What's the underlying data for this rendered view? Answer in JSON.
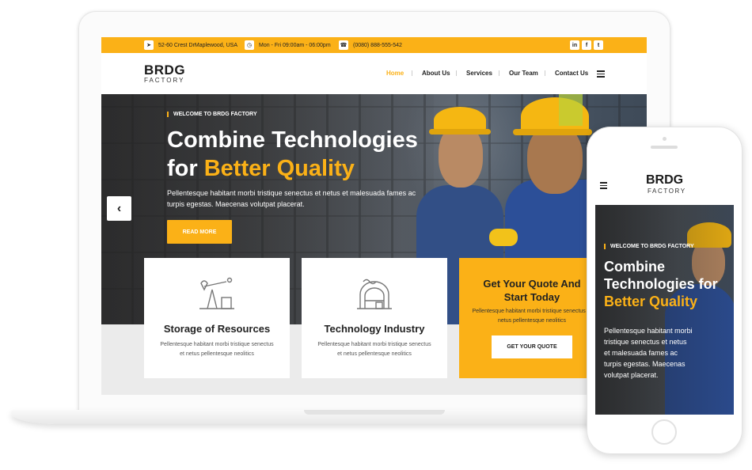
{
  "colors": {
    "accent": "#fbb117",
    "dark": "#222222",
    "white": "#ffffff"
  },
  "topbar": {
    "address": "52-60 Crest DrMaplewood, USA",
    "hours": "Mon - Fri 09:00am - 06:00pm",
    "phone": "(0080) 888-555-542",
    "address_icon": "location-arrow-icon",
    "hours_icon": "clock-icon",
    "phone_icon": "phone-icon",
    "social": [
      {
        "name": "linkedin-icon",
        "glyph": "in"
      },
      {
        "name": "facebook-icon",
        "glyph": "f"
      },
      {
        "name": "twitter-icon",
        "glyph": "t"
      }
    ]
  },
  "logo": {
    "main": "BRDG",
    "sub": "FACTORY"
  },
  "nav": {
    "items": [
      "Home",
      "About Us",
      "Services",
      "Our Team",
      "Contact Us"
    ],
    "active": "Home",
    "menu_icon": "hamburger-icon"
  },
  "hero": {
    "tag": "WELCOME TO BRDG FACTORY",
    "title_line1": "Combine Technologies",
    "title_line2_prefix": "for ",
    "title_highlight": "Better Quality",
    "text": "Pellentesque habitant morbi tristique senectus et netus et malesuada fames ac turpis egestas. Maecenas volutpat placerat.",
    "button": "READ MORE",
    "prev_icon": "chevron-left-icon"
  },
  "cards": [
    {
      "title": "Storage of Resources",
      "text": "Pellentesque habitant morbi tristique senectus et netus pellentesque neolitics",
      "icon": "oil-pump-icon"
    },
    {
      "title": "Technology Industry",
      "text": "Pellentesque habitant morbi tristique senectus et netus pellentesque neolitics",
      "icon": "warehouse-icon"
    }
  ],
  "quote": {
    "title": "Get Your Quote And Start Today",
    "text": "Pellentesque habitant morbi tristique senectus et netus pellentesque neolitics",
    "button": "GET YOUR QUOTE"
  },
  "phone": {
    "logo_main": "BRDG",
    "logo_sub": "FACTORY",
    "tag": "WELCOME TO BRDG FACTORY",
    "title_line1": "Combine",
    "title_line2": "Technologies for",
    "title_highlight": "Better Quality",
    "text": "Pellentesque habitant morbi tristique senectus et netus et malesuada fames ac turpis egestas. Maecenas volutpat placerat."
  }
}
